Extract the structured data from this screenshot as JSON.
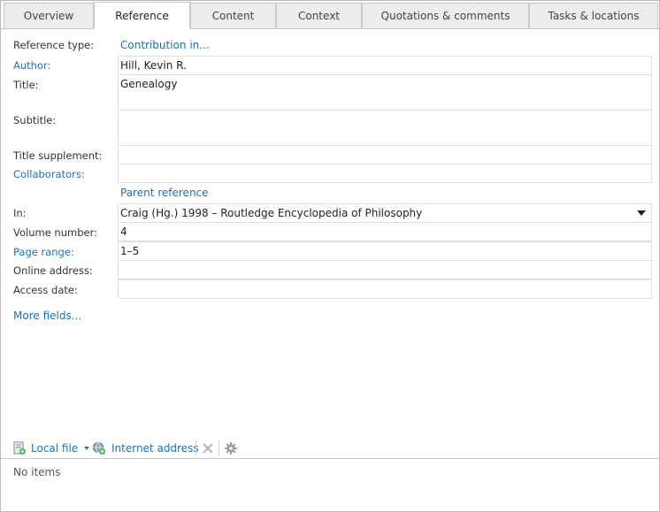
{
  "tabs": [
    {
      "label": "Overview"
    },
    {
      "label": "Reference"
    },
    {
      "label": "Content"
    },
    {
      "label": "Context"
    },
    {
      "label": "Quotations & comments"
    },
    {
      "label": "Tasks & locations"
    }
  ],
  "form": {
    "reference_type_label": "Reference type:",
    "reference_type_value": "Contribution in...",
    "author_label": "Author:",
    "author_value": "Hill, Kevin R.",
    "title_label": "Title:",
    "title_value": "Genealogy",
    "subtitle_label": "Subtitle:",
    "subtitle_value": "",
    "title_supplement_label": "Title supplement:",
    "title_supplement_value": "",
    "collaborators_label": "Collaborators:",
    "collaborators_value": "",
    "parent_reference_label": "Parent reference",
    "in_label": "In:",
    "in_value": "Craig (Hg.) 1998 – Routledge Encyclopedia of Philosophy",
    "volume_number_label": "Volume number:",
    "volume_number_value": "4",
    "page_range_label": "Page range:",
    "page_range_value": "1–5",
    "online_address_label": "Online address:",
    "online_address_value": "",
    "access_date_label": "Access date:",
    "access_date_value": "",
    "more_fields_label": "More fields..."
  },
  "toolbar": {
    "local_file_label": "Local file",
    "internet_address_label": "Internet address"
  },
  "list": {
    "empty_text": "No items"
  },
  "colors": {
    "link": "#1f6fb9",
    "tab_bg": "#ececec",
    "border": "#c8c8c8"
  }
}
